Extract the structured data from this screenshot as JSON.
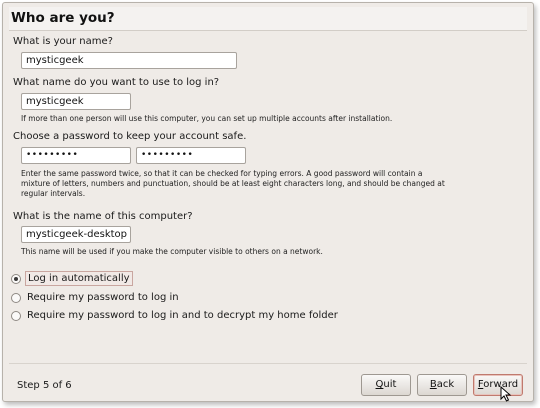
{
  "header": {
    "title": "Who are you?"
  },
  "name": {
    "label": "What is your name?",
    "value": "mysticgeek"
  },
  "login": {
    "label": "What name do you want to use to log in?",
    "value": "mysticgeek",
    "hint": "If more than one person will use this computer, you can set up multiple accounts after installation."
  },
  "password": {
    "label": "Choose a password to keep your account safe.",
    "value": "•••••••••",
    "confirm_value": "•••••••••",
    "hint_line1": "Enter the same password twice, so that it can be checked for typing errors. A good password will contain a",
    "hint_line2": "mixture of letters, numbers and punctuation, should be at least eight characters long, and should be changed at",
    "hint_line3": "regular intervals."
  },
  "computer": {
    "label": "What is the name of this computer?",
    "value": "mysticgeek-desktop",
    "hint": "This name will be used if you make the computer visible to others on a network."
  },
  "login_options": [
    {
      "label": "Log in automatically",
      "checked": true
    },
    {
      "label": "Require my password to log in",
      "checked": false
    },
    {
      "label": "Require my password to log in and to decrypt my home folder",
      "checked": false
    }
  ],
  "footer": {
    "step": "Step 5 of 6",
    "quit": {
      "mnemonic": "Q",
      "rest": "uit"
    },
    "back": {
      "mnemonic": "B",
      "rest": "ack"
    },
    "forward": {
      "mnemonic": "F",
      "rest": "orward"
    }
  }
}
